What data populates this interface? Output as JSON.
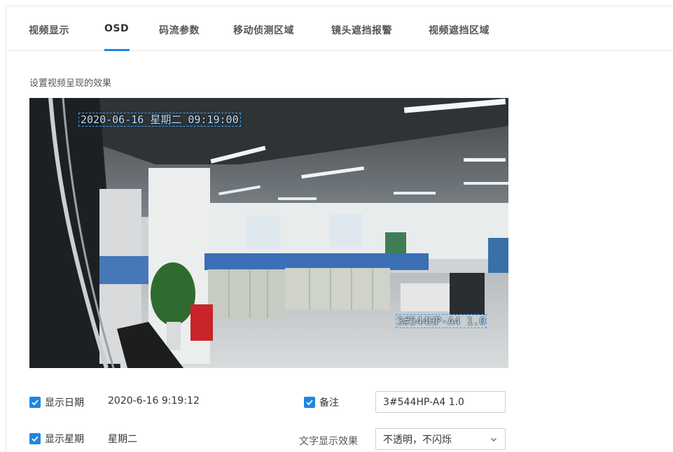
{
  "tabs": [
    {
      "label": "视频显示"
    },
    {
      "label": "OSD"
    },
    {
      "label": "码流参数"
    },
    {
      "label": "移动侦测区域"
    },
    {
      "label": "镜头遮挡报警"
    },
    {
      "label": "视频遮挡区域"
    }
  ],
  "active_tab": "OSD",
  "section_title": "设置视频呈现的效果",
  "preview": {
    "osd_date_text": "2020-06-16 星期二 09:19:00",
    "osd_remark_text": "3#544HP-A4 1.0"
  },
  "options": {
    "show_date": {
      "label": "显示日期",
      "checked": true,
      "value": "2020-6-16 9:19:12"
    },
    "show_weekday": {
      "label": "显示星期",
      "checked": true,
      "value": "星期二"
    },
    "remark": {
      "label": "备注",
      "checked": true,
      "value": "3#544HP-A4 1.0"
    },
    "text_effect": {
      "label": "文字显示效果",
      "selected": "不透明，不闪烁"
    }
  },
  "colors": {
    "accent": "#1f86e0",
    "osd_box": "#3aa0ff"
  },
  "icons": {
    "checkbox": "checkmark-icon",
    "dropdown": "chevron-down-icon"
  }
}
